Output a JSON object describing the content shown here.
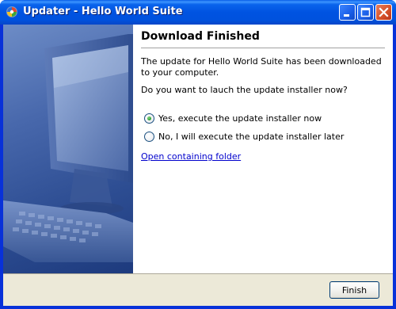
{
  "window": {
    "title": "Updater - Hello World Suite",
    "buttons": {
      "minimize_icon": "minimize-icon",
      "maximize_icon": "maximize-icon",
      "close_icon": "close-icon"
    }
  },
  "page": {
    "heading": "Download Finished",
    "message": "The update for Hello World Suite has been downloaded to your computer.",
    "question": "Do you want to lauch the update installer now?",
    "options": [
      {
        "label": "Yes, execute the update installer now",
        "selected": true
      },
      {
        "label": "No, I will execute the update installer later",
        "selected": false
      }
    ],
    "link": "Open containing folder"
  },
  "footer": {
    "finish_label": "Finish"
  },
  "colors": {
    "titlebar": "#0053e1",
    "dialog_bg": "#ece9d8",
    "link": "#0000cc",
    "sidebar": "#3a5a9e"
  }
}
